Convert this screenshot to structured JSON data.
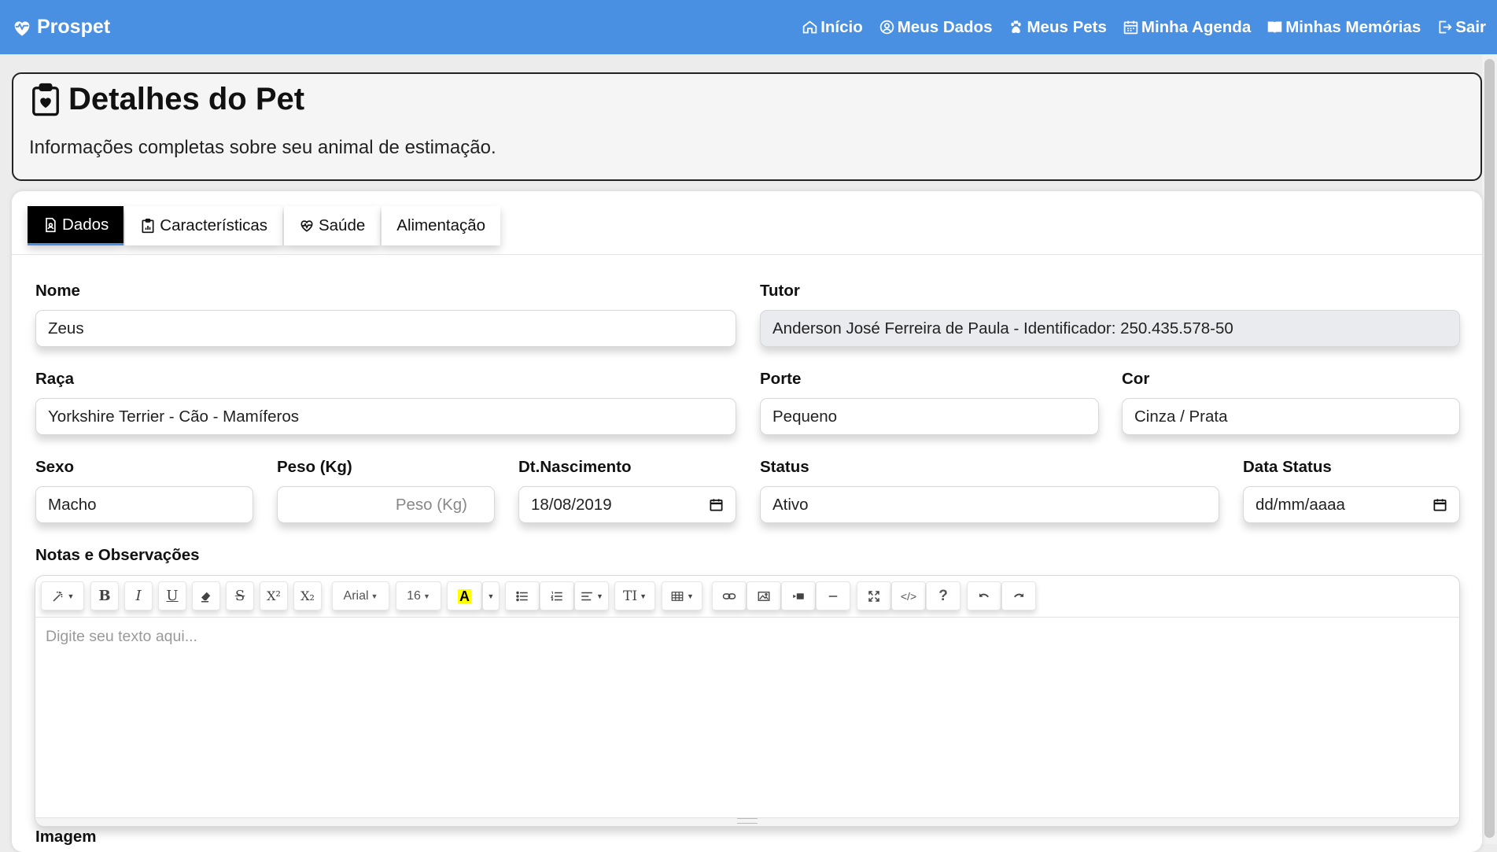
{
  "navbar": {
    "brand": "Prospet",
    "links": [
      {
        "label": "Início",
        "icon": "home-icon"
      },
      {
        "label": "Meus Dados",
        "icon": "user-circle-icon"
      },
      {
        "label": "Meus Pets",
        "icon": "paw-icon"
      },
      {
        "label": "Minha Agenda",
        "icon": "calendar-icon"
      },
      {
        "label": "Minhas Memórias",
        "icon": "book-icon"
      },
      {
        "label": "Sair",
        "icon": "logout-icon"
      }
    ]
  },
  "header": {
    "title": "Detalhes do Pet",
    "subtitle": "Informações completas sobre seu animal de estimação."
  },
  "tabs": [
    {
      "label": "Dados",
      "active": true
    },
    {
      "label": "Características",
      "active": false
    },
    {
      "label": "Saúde",
      "active": false
    },
    {
      "label": "Alimentação",
      "active": false
    }
  ],
  "form": {
    "nome": {
      "label": "Nome",
      "value": "Zeus"
    },
    "tutor": {
      "label": "Tutor",
      "value": "Anderson José Ferreira de Paula - Identificador: 250.435.578-50"
    },
    "raca": {
      "label": "Raça",
      "value": "Yorkshire Terrier - Cão - Mamíferos"
    },
    "porte": {
      "label": "Porte",
      "value": "Pequeno"
    },
    "cor": {
      "label": "Cor",
      "value": "Cinza / Prata"
    },
    "sexo": {
      "label": "Sexo",
      "value": "Macho"
    },
    "peso": {
      "label": "Peso (Kg)",
      "placeholder": "Peso (Kg)"
    },
    "nascimento": {
      "label": "Dt.Nascimento",
      "value": "18/08/2019"
    },
    "status": {
      "label": "Status",
      "value": "Ativo"
    },
    "data_status": {
      "label": "Data Status",
      "value": "dd/mm/aaaa"
    },
    "notas": {
      "label": "Notas e Observações",
      "placeholder": "Digite seu texto aqui..."
    },
    "imagem": {
      "label": "Imagem"
    }
  },
  "editor_toolbar": {
    "font_name": "Arial",
    "font_size": "16",
    "bold": "B",
    "italic": "I",
    "underline": "U",
    "strike": "S",
    "superscript": "X²",
    "subscript": "X₂",
    "text_color": "A",
    "text_style": "TI",
    "code": "</>",
    "help": "?",
    "highlight_color": "#ffff00"
  },
  "colors": {
    "navbar": "#4a90e2",
    "active_tab": "#000000"
  }
}
